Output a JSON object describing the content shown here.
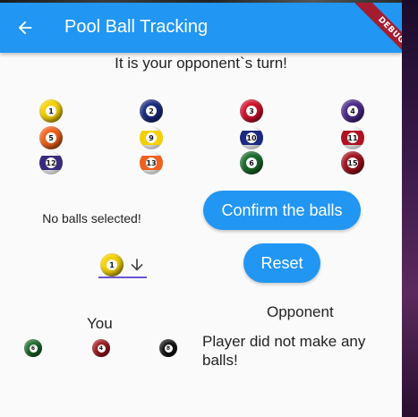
{
  "appbar": {
    "title": "Pool Ball Tracking",
    "back_icon": "arrow-back-icon",
    "debug_banner": "DEBUG"
  },
  "status_text": "It is your opponent`s turn!",
  "balls": [
    {
      "number": "1",
      "color": "#f4d000",
      "striped": false
    },
    {
      "number": "2",
      "color": "#1b2a80",
      "striped": false
    },
    {
      "number": "3",
      "color": "#d0102a",
      "striped": false
    },
    {
      "number": "4",
      "color": "#4a2a8a",
      "striped": false
    },
    {
      "number": "5",
      "color": "#f0601a",
      "striped": false
    },
    {
      "number": "9",
      "color": "#f4d000",
      "striped": true
    },
    {
      "number": "10",
      "color": "#1b2a80",
      "striped": true
    },
    {
      "number": "11",
      "color": "#b01020",
      "striped": true
    },
    {
      "number": "12",
      "color": "#3a2a7a",
      "striped": true
    },
    {
      "number": "13",
      "color": "#f06020",
      "striped": true
    },
    {
      "number": "6",
      "color": "#1a6a2a",
      "striped": false
    },
    {
      "number": "15",
      "color": "#a0101a",
      "striped": false
    }
  ],
  "selection": {
    "text": "No balls selected!",
    "dropdown_ball": {
      "number": "1",
      "color": "#f4d000"
    },
    "dropdown_icon": "arrow-down-icon"
  },
  "buttons": {
    "confirm": "Confirm the balls",
    "reset": "Reset"
  },
  "you": {
    "label": "You",
    "balls": [
      {
        "number": "6",
        "color": "#1a6a2a"
      },
      {
        "number": "4",
        "color": "#a01820"
      },
      {
        "number": "8",
        "color": "#111111"
      }
    ]
  },
  "opponent": {
    "label": "Opponent",
    "message": "Player did not make any balls!"
  }
}
